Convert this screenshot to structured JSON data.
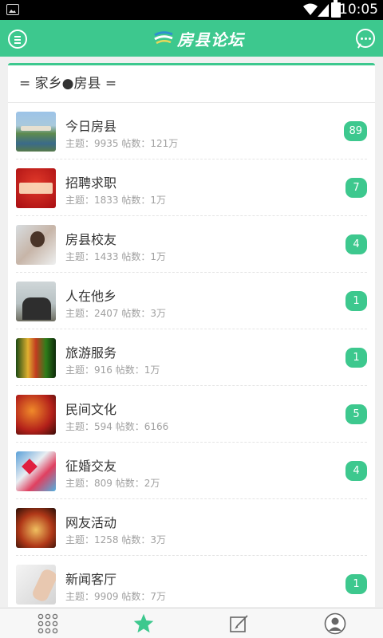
{
  "status_bar": {
    "time": "10:05"
  },
  "app_bar": {
    "title": "房县论坛"
  },
  "section": {
    "title": "= 家乡●房县 ="
  },
  "forums": [
    {
      "name": "今日房县",
      "stats": "主题：9935 帖数：121万",
      "badge": "89",
      "thumb": "river-town"
    },
    {
      "name": "招聘求职",
      "stats": "主题：1833 帖数：1万",
      "badge": "7",
      "thumb": "recruit-red"
    },
    {
      "name": "房县校友",
      "stats": "主题：1433 帖数：1万",
      "badge": "4",
      "thumb": "smiling-girl"
    },
    {
      "name": "人在他乡",
      "stats": "主题：2407 帖数：3万",
      "badge": "1",
      "thumb": "friends-cheering"
    },
    {
      "name": "旅游服务",
      "stats": "主题：916 帖数：1万",
      "badge": "1",
      "thumb": "cave-lights"
    },
    {
      "name": "民间文化",
      "stats": "主题：594 帖数：6166",
      "badge": "5",
      "thumb": "folk-lanterns"
    },
    {
      "name": "征婚交友",
      "stats": "主题：809 帖数：2万",
      "badge": "4",
      "thumb": "keyboard-hearts"
    },
    {
      "name": "网友活动",
      "stats": "主题：1258 帖数：3万",
      "badge": "",
      "thumb": "party-toast"
    },
    {
      "name": "新闻客厅",
      "stats": "主题：9909 帖数：7万",
      "badge": "1",
      "thumb": "writing-hand"
    }
  ],
  "tabs": [
    {
      "id": "forums",
      "icon": "grid-dots-icon"
    },
    {
      "id": "favorites",
      "icon": "star-icon",
      "active": true
    },
    {
      "id": "post",
      "icon": "compose-icon"
    },
    {
      "id": "profile",
      "icon": "user-icon"
    }
  ],
  "colors": {
    "accent": "#3dc88e",
    "text": "#333333",
    "subtext": "#a0a0a0"
  }
}
